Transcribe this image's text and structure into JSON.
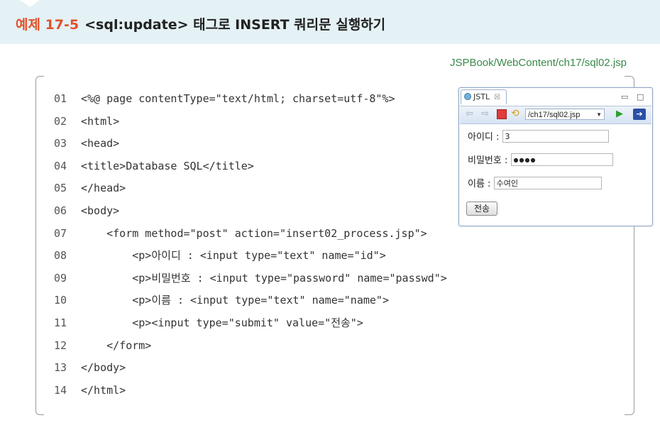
{
  "header": {
    "number": "예제 17-5",
    "title": "<sql:update> 태그로 INSERT 쿼리문 실행하기"
  },
  "file_path": "JSPBook/WebContent/ch17/sql02.jsp",
  "code": [
    {
      "num": "01",
      "text": "<%@ page contentType=\"text/html; charset=utf-8\"%>"
    },
    {
      "num": "02",
      "text": "<html>"
    },
    {
      "num": "03",
      "text": "<head>"
    },
    {
      "num": "04",
      "text": "<title>Database SQL</title>"
    },
    {
      "num": "05",
      "text": "</head>"
    },
    {
      "num": "06",
      "text": "<body>"
    },
    {
      "num": "07",
      "text": "    <form method=\"post\" action=\"insert02_process.jsp\">"
    },
    {
      "num": "08",
      "text": "        <p>아이디 : <input type=\"text\" name=\"id\">"
    },
    {
      "num": "09",
      "text": "        <p>비밀번호 : <input type=\"password\" name=\"passwd\">"
    },
    {
      "num": "10",
      "text": "        <p>이름 : <input type=\"text\" name=\"name\">"
    },
    {
      "num": "11",
      "text": "        <p><input type=\"submit\" value=\"전송\">"
    },
    {
      "num": "12",
      "text": "    </form>"
    },
    {
      "num": "13",
      "text": "</body>"
    },
    {
      "num": "14",
      "text": "</html>"
    }
  ],
  "browser": {
    "tab_label": "JSTL",
    "tab_close": "☒",
    "url": "/ch17/sql02.jsp",
    "fields": {
      "id_label": "아이디 :",
      "id_value": "3",
      "passwd_label": "비밀번호 :",
      "passwd_value": "●●●●",
      "name_label": "이름 :",
      "name_value": "수여인"
    },
    "submit_label": "전송"
  },
  "colors": {
    "accent": "#e0522a",
    "header_bg": "#e4f1f5",
    "path_green": "#3a8a4a"
  }
}
